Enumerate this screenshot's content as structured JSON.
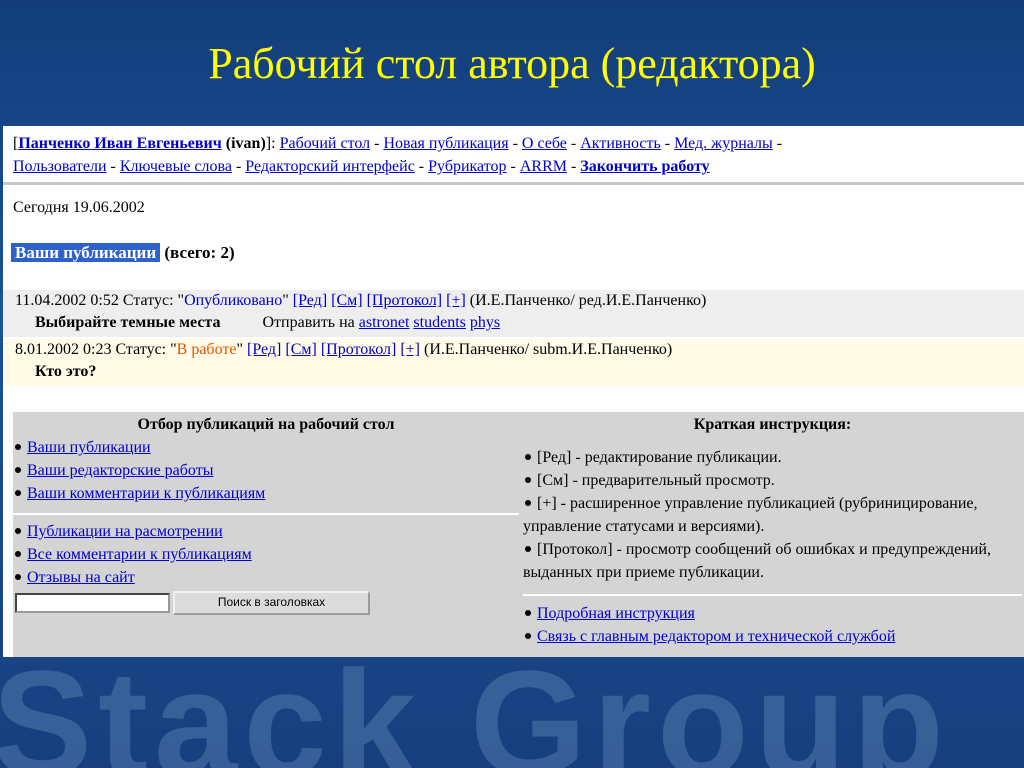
{
  "slide": {
    "title": "Рабочий стол автора (редактора)",
    "watermark": "Stack Group"
  },
  "nav": {
    "user_name": "Панченко Иван Евгеньевич",
    "login": "(ivan)",
    "links": [
      "Рабочий стол",
      "Новая публикация",
      "О себе",
      "Активность",
      "Мед. журналы",
      "Пользователи",
      "Ключевые слова",
      "Редакторский интерфейс",
      "Рубрикатор",
      "ARRM",
      "Закончить работу"
    ]
  },
  "today": "Сегодня 19.06.2002",
  "publications": {
    "heading": "Ваши публикации",
    "count": "(всего: 2)",
    "items": [
      {
        "datetime": "11.04.2002 0:52",
        "status_label": "Статус:",
        "status": "Опубликовано",
        "edit": "[Ред]",
        "view": "[См]",
        "protocol": "[Протокол]",
        "plus": "[+]",
        "authors": "(И.Е.Панченко/ ред.И.Е.Панченко)",
        "title": "Выбирайте темные места",
        "send_label": "Отправить на",
        "send_targets": [
          "astronet",
          "students",
          "phys"
        ]
      },
      {
        "datetime": "8.01.2002 0:23",
        "status_label": "Статус:",
        "status": "В работе",
        "edit": "[Ред]",
        "view": "[См]",
        "protocol": "[Протокол]",
        "plus": "[+]",
        "authors": "(И.Е.Панченко/ subm.И.Е.Панченко)",
        "title": "Кто это?"
      }
    ]
  },
  "filter": {
    "heading": "Отбор публикаций на рабочий стол",
    "group1": [
      "Ваши публикации",
      "Ваши редакторские работы",
      "Ваши комментарии к публикациям"
    ],
    "group2": [
      "Публикации на расмотрении",
      "Все комментарии к публикациям",
      "Отзывы на сайт"
    ],
    "search_button": "Поиск в заголовках",
    "search_value": ""
  },
  "instructions": {
    "heading": "Краткая инструкция:",
    "items": [
      "[Ред] - редактирование публикации.",
      "[См] - предварительный просмотр.",
      "[+] - расширенное управление публикацией (рубриницирование, управление статусами и версиями).",
      "[Протокол] - просмотр сообщений об ошибках и предупреждений, выданных при приеме публикации."
    ],
    "links": [
      "Подробная инструкция",
      "Связь с главным редактором и технической службой"
    ]
  },
  "colors": {
    "title": "#ffff00",
    "link": "#0000cc",
    "status_published": "#0000cc",
    "status_in_work": "#dd5500",
    "highlight": "#2f62c8"
  }
}
